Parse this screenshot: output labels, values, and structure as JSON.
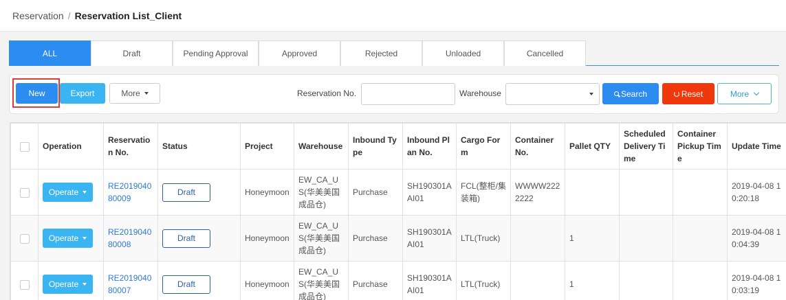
{
  "breadcrumb": {
    "parent": "Reservation",
    "separator": "/",
    "current": "Reservation List_Client"
  },
  "tabs": [
    "ALL",
    "Draft",
    "Pending Approval",
    "Approved",
    "Rejected",
    "Unloaded",
    "Cancelled"
  ],
  "toolbar": {
    "new_label": "New",
    "export_label": "Export",
    "more_label": "More",
    "reservation_no_label": "Reservation No.",
    "reservation_no_value": "",
    "warehouse_label": "Warehouse",
    "warehouse_value": "",
    "search_label": "Search",
    "reset_label": "Reset",
    "more2_label": "More"
  },
  "table": {
    "headers": [
      "Operation",
      "Reservation No.",
      "Status",
      "Project",
      "Warehouse",
      "Inbound Type",
      "Inbound Plan No.",
      "Cargo Form",
      "Container No.",
      "Pallet QTY",
      "Scheduled Delivery Time",
      "Container Pickup Time",
      "Update Time"
    ],
    "rows": [
      {
        "operate": "Operate",
        "reservation_no": "RE201904080009",
        "status": "Draft",
        "project": "Honeymoon",
        "warehouse": "EW_CA_US(华美美国成品仓)",
        "inbound_type": "Purchase",
        "inbound_plan_no": "SH190301AAI01",
        "cargo_form": "FCL(整柜/集装箱)",
        "container_no": "WWWW2222222",
        "pallet_qty": "",
        "scheduled_delivery": "",
        "container_pickup": "",
        "update_time": "2019-04-08 10:20:18"
      },
      {
        "operate": "Operate",
        "reservation_no": "RE201904080008",
        "status": "Draft",
        "project": "Honeymoon",
        "warehouse": "EW_CA_US(华美美国成品仓)",
        "inbound_type": "Purchase",
        "inbound_plan_no": "SH190301AAI01",
        "cargo_form": "LTL(Truck)",
        "container_no": "",
        "pallet_qty": "1",
        "scheduled_delivery": "",
        "container_pickup": "",
        "update_time": "2019-04-08 10:04:39"
      },
      {
        "operate": "Operate",
        "reservation_no": "RE201904080007",
        "status": "Draft",
        "project": "Honeymoon",
        "warehouse": "EW_CA_US(华美美国成品仓)",
        "inbound_type": "Purchase",
        "inbound_plan_no": "SH190301AAI01",
        "cargo_form": "LTL(Truck)",
        "container_no": "",
        "pallet_qty": "1",
        "scheduled_delivery": "",
        "container_pickup": "",
        "update_time": "2019-04-08 10:03:19"
      }
    ]
  },
  "colors": {
    "primary": "#2d8cf0",
    "info": "#3bb4f2",
    "danger": "#f0380c",
    "highlight": "#e53935"
  }
}
